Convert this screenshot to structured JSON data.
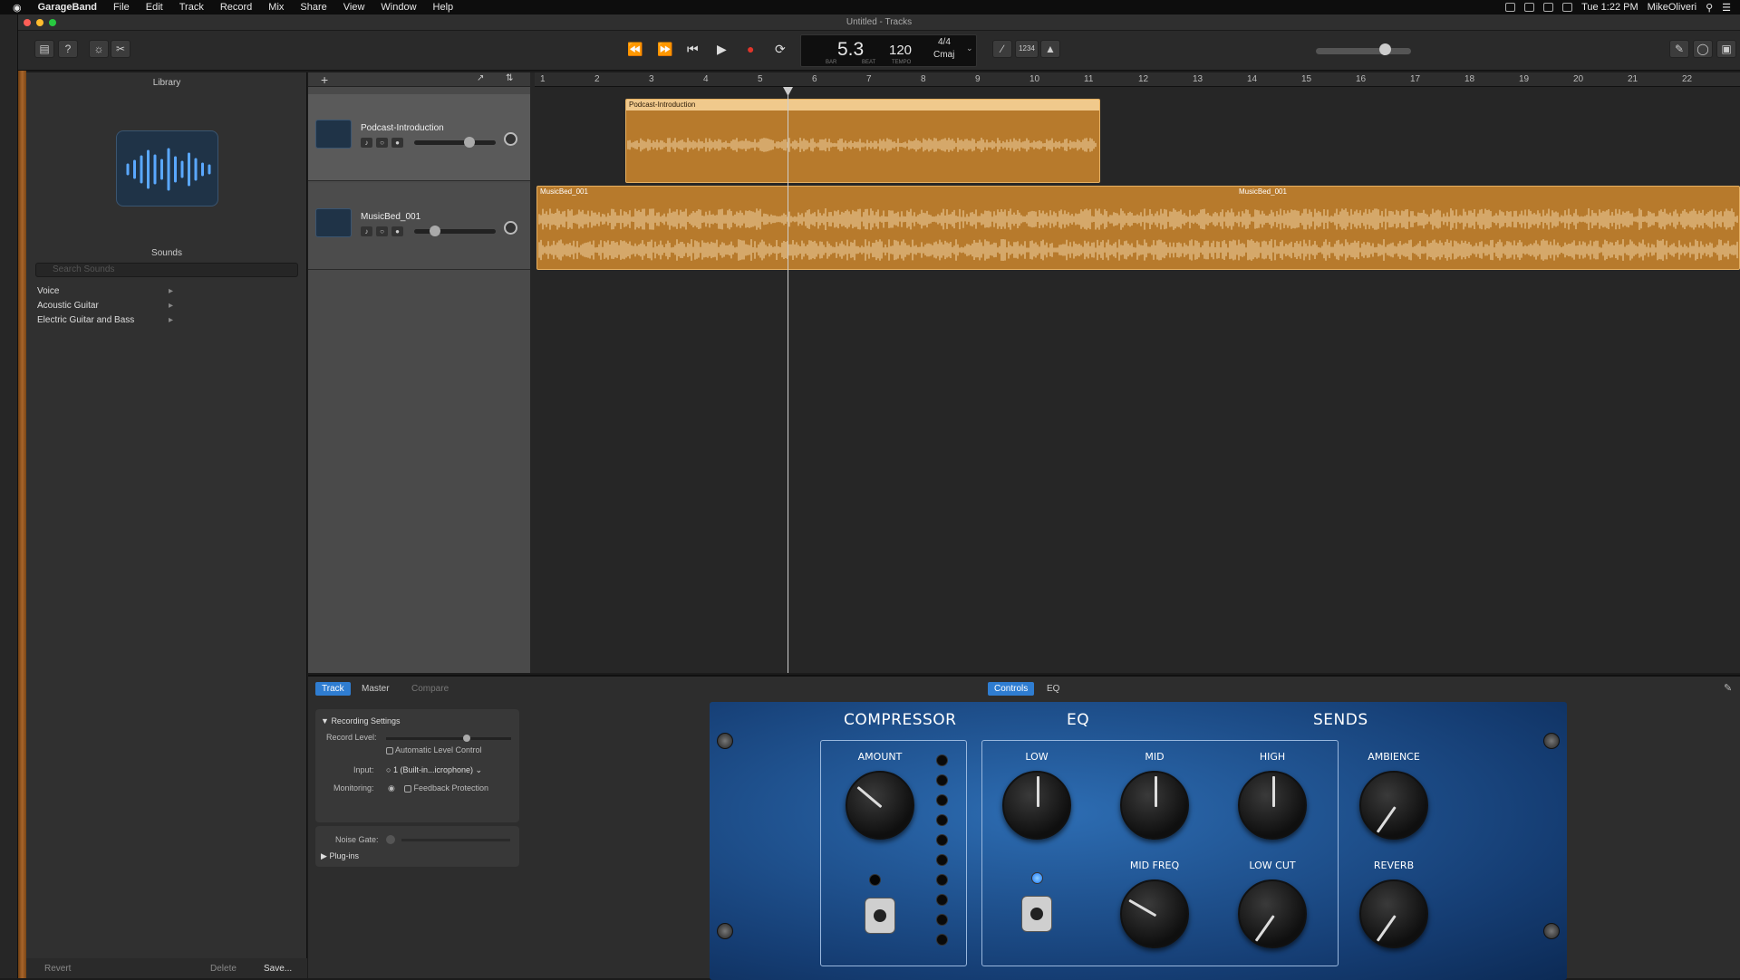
{
  "menubar": {
    "apple": "",
    "app": "GarageBand",
    "items": [
      "File",
      "Edit",
      "Track",
      "Record",
      "Mix",
      "Share",
      "View",
      "Window",
      "Help"
    ],
    "clock": "Tue 1:22 PM",
    "user": "MikeOliveri"
  },
  "window": {
    "title": "Untitled - Tracks"
  },
  "lcd": {
    "position": "5.3",
    "bar_label": "BAR",
    "beat_label": "BEAT",
    "tempo": "120",
    "tempo_label": "TEMPO",
    "signature": "4/4",
    "key": "Cmaj",
    "count_in": "1234"
  },
  "library": {
    "title": "Library",
    "sounds_title": "Sounds",
    "search_placeholder": "Search Sounds",
    "categories": [
      "Voice",
      "Acoustic Guitar",
      "Electric Guitar and Bass"
    ],
    "footer": {
      "revert": "Revert",
      "delete": "Delete",
      "save": "Save..."
    }
  },
  "ruler": {
    "bars": [
      "1",
      "2",
      "3",
      "4",
      "5",
      "6",
      "7",
      "8",
      "9",
      "10",
      "11",
      "12",
      "13",
      "14",
      "15",
      "16",
      "17",
      "18",
      "19",
      "20",
      "21",
      "22"
    ]
  },
  "tracks": [
    {
      "name": "Podcast-Introduction",
      "region": "Podcast-Introduction"
    },
    {
      "name": "MusicBed_001",
      "region": "MusicBed_001",
      "region2": "MusicBed_001"
    }
  ],
  "bottom": {
    "tabs": [
      "Track",
      "Master",
      "Compare"
    ],
    "view_tabs": [
      "Controls",
      "EQ"
    ],
    "recording": {
      "header": "Recording Settings",
      "record_level": "Record Level:",
      "auto_level": "Automatic Level Control",
      "input_label": "Input:",
      "input_value": "1 (Built-in...icrophone)",
      "monitoring_label": "Monitoring:",
      "feedback": "Feedback Protection",
      "noise_gate": "Noise Gate:",
      "plugins": "Plug-ins"
    }
  },
  "amp": {
    "sections": [
      "COMPRESSOR",
      "EQ",
      "SENDS"
    ],
    "knobs": {
      "amount": "AMOUNT",
      "low": "LOW",
      "mid": "MID",
      "high": "HIGH",
      "ambience": "AMBIENCE",
      "mid_freq": "MID FREQ",
      "low_cut": "LOW CUT",
      "reverb": "REVERB"
    }
  },
  "colors": {
    "region": "#b77a2c",
    "accent": "#2f7dd1",
    "amp_blue": "#1f5598"
  }
}
